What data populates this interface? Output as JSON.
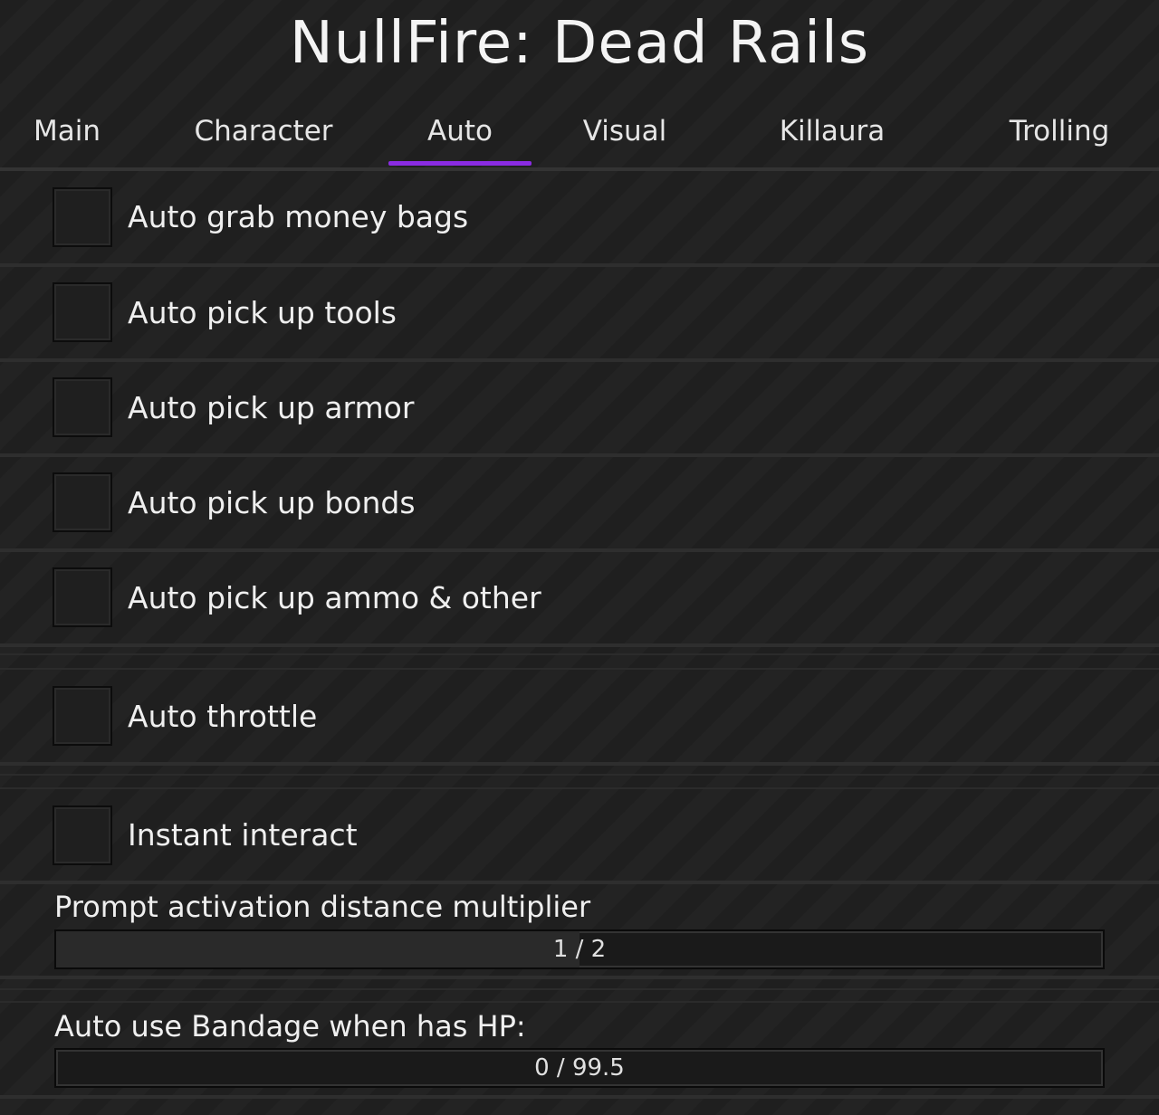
{
  "window": {
    "title": "NullFire: Dead Rails"
  },
  "tabs": [
    {
      "label": "Main"
    },
    {
      "label": "Character"
    },
    {
      "label": "Auto",
      "active": true
    },
    {
      "label": "Visual"
    },
    {
      "label": "Killaura"
    },
    {
      "label": "Trolling"
    }
  ],
  "accent_color": "#8a2be2",
  "toggles": [
    {
      "label": "Auto grab money bags",
      "checked": false
    },
    {
      "label": "Auto pick up tools",
      "checked": false
    },
    {
      "label": "Auto pick up armor",
      "checked": false
    },
    {
      "label": "Auto pick up bonds",
      "checked": false
    },
    {
      "label": "Auto pick up ammo & other",
      "checked": false
    },
    {
      "label": "Auto throttle",
      "checked": false
    },
    {
      "label": "Instant interact",
      "checked": false
    }
  ],
  "sliders": [
    {
      "label": "Prompt activation distance multiplier",
      "value_text": "1 / 2",
      "value": 1,
      "max": 2
    },
    {
      "label": "Auto use Bandage when has HP:",
      "value_text": "0 / 99.5",
      "value": 0,
      "max": 99.5
    }
  ]
}
